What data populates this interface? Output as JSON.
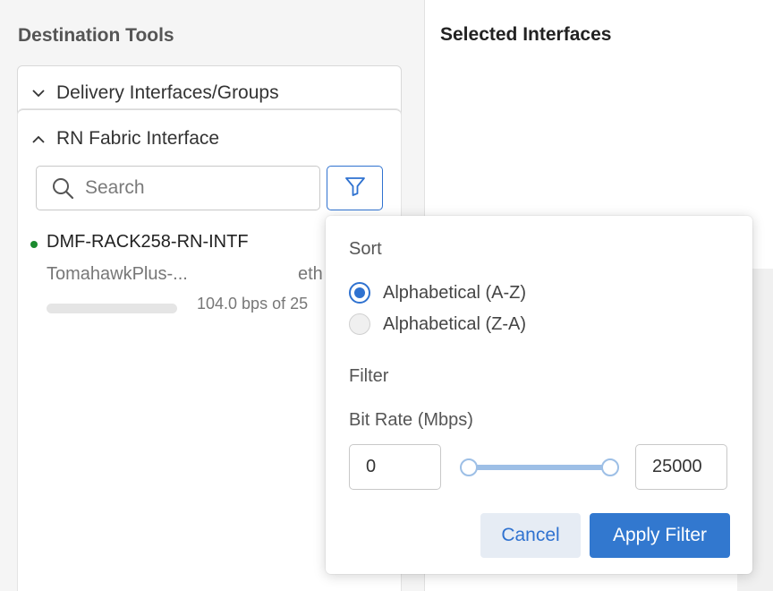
{
  "left": {
    "title": "Destination Tools",
    "delivery_header": "Delivery Interfaces/Groups",
    "rn_header": "RN Fabric Interface",
    "search": {
      "placeholder": "Search"
    },
    "interface": {
      "name": "DMF-RACK258-RN-INTF",
      "switch": "TomahawkPlus-...",
      "port": "eth",
      "utilization": "104.0 bps of 25",
      "status_color": "#1a8a2e"
    }
  },
  "right": {
    "title": "Selected Interfaces"
  },
  "popover": {
    "sort_heading": "Sort",
    "sort_options": [
      {
        "label": "Alphabetical (A-Z)",
        "selected": true
      },
      {
        "label": "Alphabetical (Z-A)",
        "selected": false
      }
    ],
    "filter_heading": "Filter",
    "bitrate_label": "Bit Rate (Mbps)",
    "min_value": "0",
    "max_value": "25000",
    "cancel_label": "Cancel",
    "apply_label": "Apply Filter"
  },
  "colors": {
    "accent": "#2f72d0",
    "apply_bg": "#3278cf",
    "cancel_bg": "#e6ecf4",
    "status_green": "#1a8a2e"
  },
  "icons": [
    "chevron-down-icon",
    "chevron-up-icon",
    "search-icon",
    "filter-icon"
  ]
}
